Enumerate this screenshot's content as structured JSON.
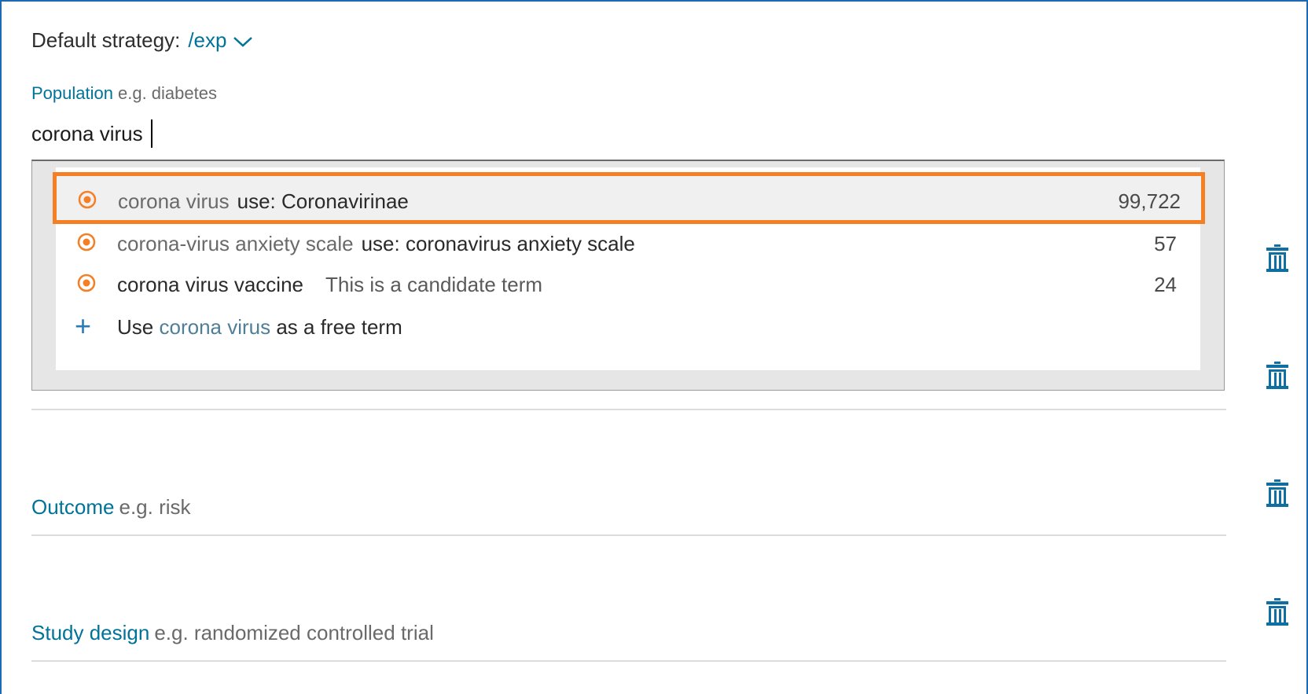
{
  "strategy": {
    "label": "Default strategy:",
    "value": "/exp"
  },
  "population": {
    "label": "Population",
    "hint": "e.g. diabetes",
    "value": "corona virus"
  },
  "dropdown": {
    "options": [
      {
        "term": "corona virus",
        "use": "use: Coronavirinae",
        "count": "99,722",
        "icon": "radio-target-icon",
        "highlighted": true
      },
      {
        "term": "corona-virus anxiety scale",
        "use": "use: coronavirus anxiety scale",
        "count": "57",
        "icon": "radio-target-icon"
      },
      {
        "term": "corona virus vaccine",
        "note": "This is a candidate term",
        "count": "24",
        "icon": "radio-target-icon"
      }
    ],
    "free_term": {
      "prefix": "Use",
      "term": "corona virus",
      "suffix": "as a free term",
      "icon": "plus-icon"
    }
  },
  "outcome": {
    "label": "Outcome",
    "hint": "e.g. risk"
  },
  "study_design": {
    "label": "Study design",
    "hint": "e.g. randomized controlled trial"
  },
  "colors": {
    "accent": "#007398",
    "highlight_border": "#f47f24",
    "radio": "#f47f24",
    "frame": "#1c69b5"
  }
}
